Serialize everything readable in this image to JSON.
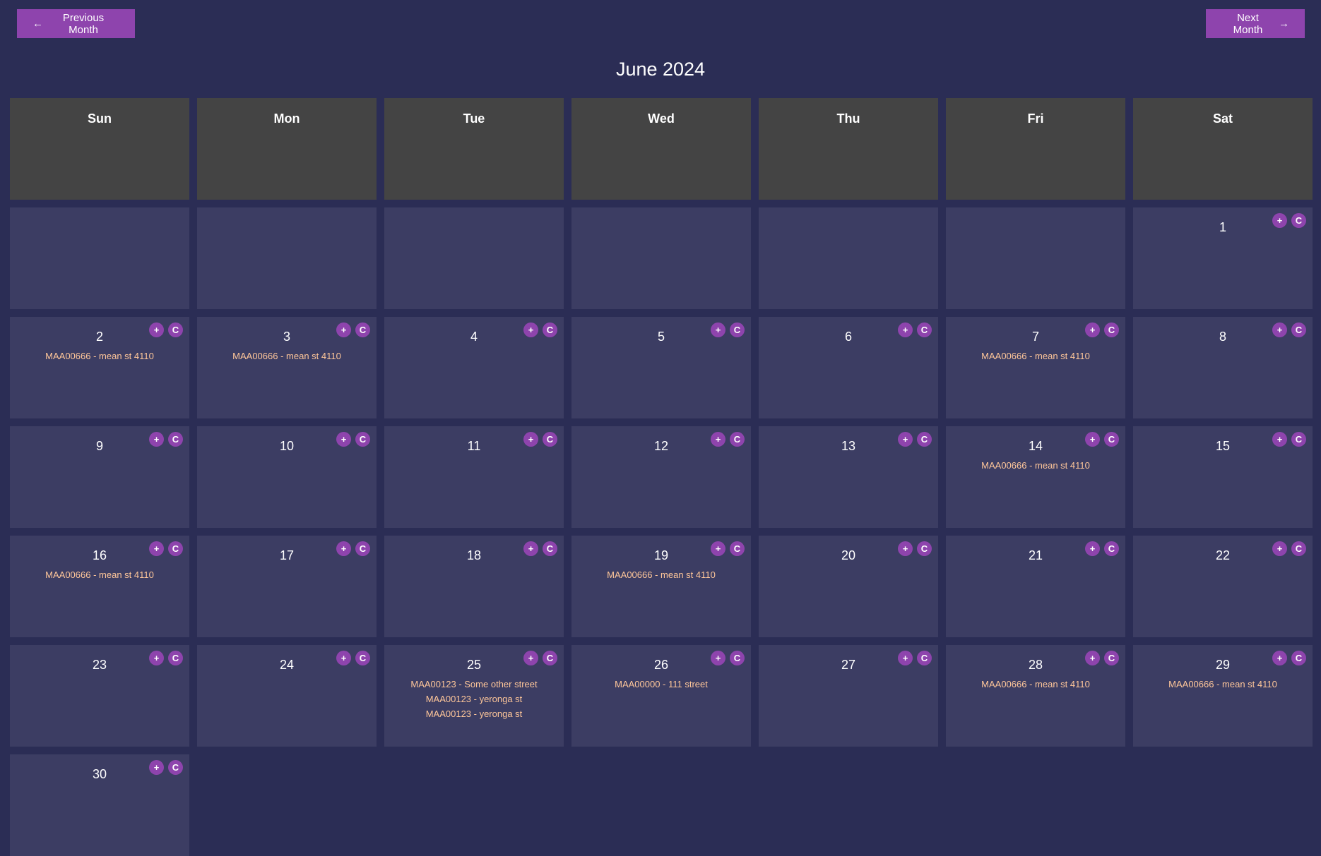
{
  "nav": {
    "prev_label": "Previous Month",
    "next_label": "Next Month",
    "prev_arrow": "←",
    "next_arrow": "→"
  },
  "calendar": {
    "title": "June 2024",
    "weekdays": [
      "Sun",
      "Mon",
      "Tue",
      "Wed",
      "Thu",
      "Fri",
      "Sat"
    ],
    "leading_blank_days": 6,
    "add_label": "+",
    "copy_label": "C",
    "days": [
      {
        "day": "1",
        "events": []
      },
      {
        "day": "2",
        "events": [
          "MAA00666 - mean st 4110"
        ]
      },
      {
        "day": "3",
        "events": [
          "MAA00666 - mean st 4110"
        ]
      },
      {
        "day": "4",
        "events": []
      },
      {
        "day": "5",
        "events": []
      },
      {
        "day": "6",
        "events": []
      },
      {
        "day": "7",
        "events": [
          "MAA00666 - mean st 4110"
        ]
      },
      {
        "day": "8",
        "events": []
      },
      {
        "day": "9",
        "events": []
      },
      {
        "day": "10",
        "events": []
      },
      {
        "day": "11",
        "events": []
      },
      {
        "day": "12",
        "events": []
      },
      {
        "day": "13",
        "events": []
      },
      {
        "day": "14",
        "events": [
          "MAA00666 - mean st 4110"
        ]
      },
      {
        "day": "15",
        "events": []
      },
      {
        "day": "16",
        "events": [
          "MAA00666 - mean st 4110"
        ]
      },
      {
        "day": "17",
        "events": []
      },
      {
        "day": "18",
        "events": []
      },
      {
        "day": "19",
        "events": [
          "MAA00666 - mean st 4110"
        ]
      },
      {
        "day": "20",
        "events": []
      },
      {
        "day": "21",
        "events": []
      },
      {
        "day": "22",
        "events": []
      },
      {
        "day": "23",
        "events": []
      },
      {
        "day": "24",
        "events": []
      },
      {
        "day": "25",
        "events": [
          "MAA00123 - Some other street",
          "MAA00123 - yeronga st",
          "MAA00123 - yeronga st"
        ]
      },
      {
        "day": "26",
        "events": [
          "MAA00000 - 111 street"
        ]
      },
      {
        "day": "27",
        "events": []
      },
      {
        "day": "28",
        "events": [
          "MAA00666 - mean st 4110"
        ]
      },
      {
        "day": "29",
        "events": [
          "MAA00666 - mean st 4110"
        ]
      },
      {
        "day": "30",
        "events": []
      }
    ]
  },
  "colors": {
    "background": "#2b2d55",
    "cell": "#3c3d63",
    "header_cell": "#444444",
    "accent": "#8e44ad",
    "event_text": "#ffc79a"
  }
}
